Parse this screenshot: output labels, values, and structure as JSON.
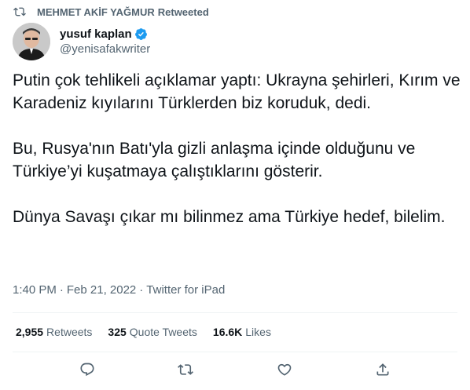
{
  "retweet_banner": {
    "name": "MEHMET AKİF YAĞMUR",
    "suffix": "Retweeted"
  },
  "author": {
    "display_name": "yusuf kaplan",
    "handle": "@yenisafakwriter"
  },
  "tweet": {
    "paragraphs": [
      "Putin çok tehlikeli açıklamar yaptı: Ukrayna şehirleri, Kırım ve Karadeniz kıyılarını Türklerden biz koruduk, dedi.",
      "Bu, Rusya'nın Batı'yla gizli anlaşma içinde olduğunu ve Türkiye’yi kuşatmaya çalıştıklarını gösterir.",
      "Dünya Savaşı çıkar mı bilinmez ama Türkiye hedef, bilelim."
    ]
  },
  "meta": {
    "time": "1:40 PM",
    "separator": "·",
    "date": "Feb 21, 2022",
    "source": "Twitter for iPad"
  },
  "stats": {
    "retweets": {
      "count": "2,955",
      "label": "Retweets"
    },
    "quotes": {
      "count": "325",
      "label": "Quote Tweets"
    },
    "likes": {
      "count": "16.6K",
      "label": "Likes"
    }
  },
  "colors": {
    "secondary_text": "#536471",
    "verified_blue": "#1d9bf0",
    "divider": "#eff3f4"
  },
  "icons": [
    "retweet-icon",
    "verified-icon",
    "reply-icon",
    "like-icon",
    "share-icon"
  ]
}
